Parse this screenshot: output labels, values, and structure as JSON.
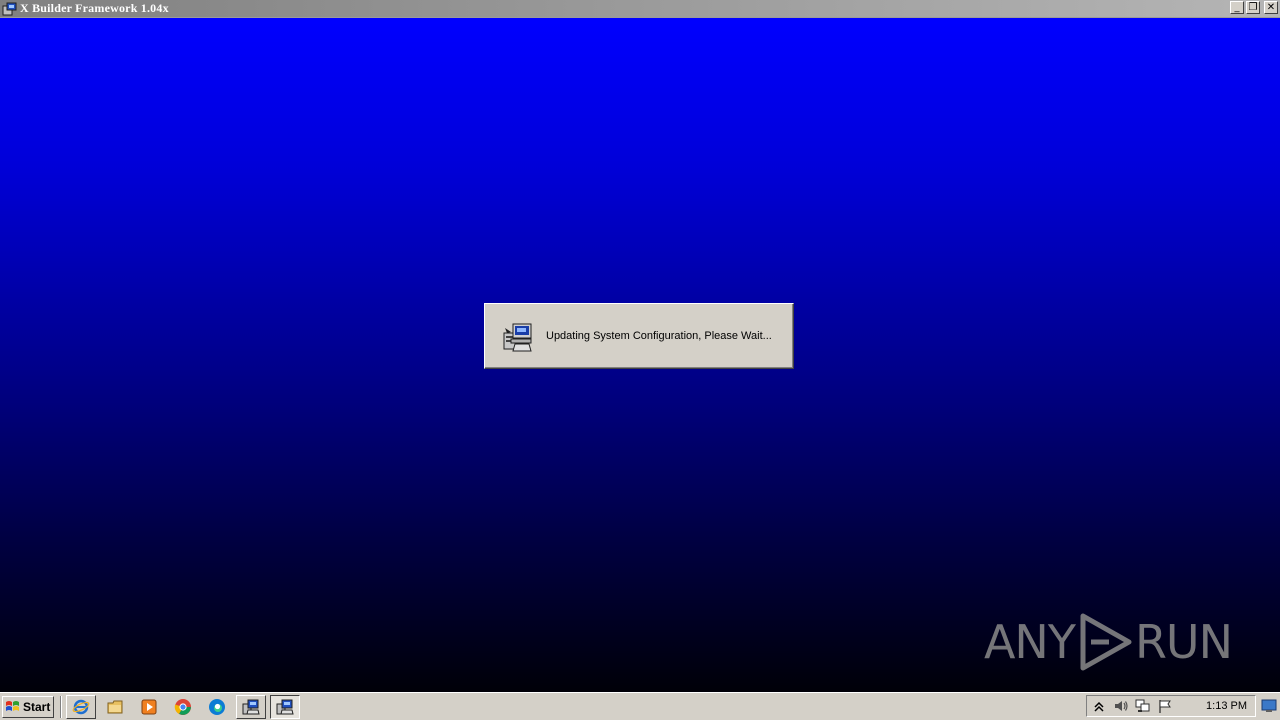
{
  "window": {
    "title": "X Builder Framework 1.04x",
    "controls": {
      "minimize": "_",
      "restore": "❐",
      "close": "✕"
    }
  },
  "dialog": {
    "message": "Updating System Configuration, Please Wait...",
    "icon": "installer-computer-icon"
  },
  "watermark": {
    "left": "ANY",
    "right": "RUN"
  },
  "taskbar": {
    "start_label": "Start",
    "quicklaunch": [
      "internet-explorer-icon",
      "file-explorer-icon",
      "media-player-icon",
      "chrome-icon",
      "edge-icon"
    ],
    "tasks": [
      "installer-task-icon",
      "installer-task-icon"
    ],
    "tray_icons": [
      "show-hidden-icons-icon",
      "volume-icon",
      "network-icon",
      "action-center-flag-icon"
    ],
    "clock": "1:13 PM"
  },
  "colors": {
    "gradient_top": "#0000ff",
    "gradient_bottom": "#000008",
    "face": "#d4d0c8",
    "title_start": "#808080",
    "title_end": "#b5b5b5"
  }
}
